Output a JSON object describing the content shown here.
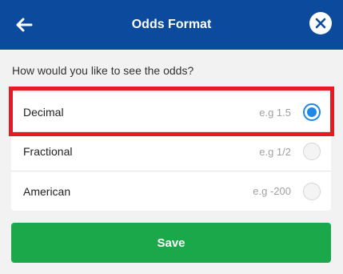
{
  "header": {
    "title": "Odds Format",
    "back_icon": "arrow-left-icon",
    "close_icon": "close-circle-icon"
  },
  "prompt": "How would you like to see the odds?",
  "options": [
    {
      "label": "Decimal",
      "example": "e.g 1.5",
      "selected": true
    },
    {
      "label": "Fractional",
      "example": "e.g 1/2",
      "selected": false
    },
    {
      "label": "American",
      "example": "e.g -200",
      "selected": false
    }
  ],
  "save_label": "Save",
  "colors": {
    "header_bg": "#0b4a9c",
    "accent": "#1e88e5",
    "save_bg": "#1aa84b",
    "highlight": "#e31b23"
  }
}
